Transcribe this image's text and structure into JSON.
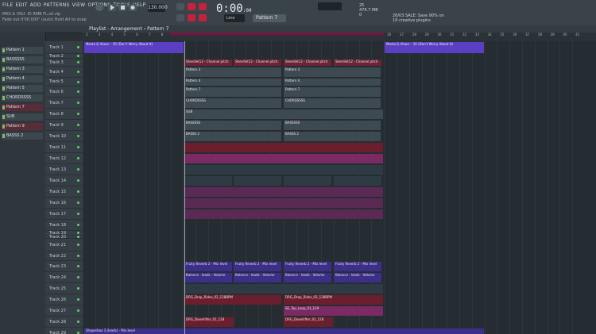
{
  "menu": [
    "FILE",
    "EDIT",
    "ADD",
    "PATTERNS",
    "VIEW",
    "OPTIONS",
    "TOOLS",
    "HELP"
  ],
  "hint": {
    "line1": "MKS & VKU- ID RMB FL.stl.zip",
    "line2": "Fade out   0'00.000\" (auto)    Hold Alt to snap"
  },
  "bpm": "130.000",
  "time": {
    "main": "0:00",
    "small": ":00"
  },
  "line_mode": "Line",
  "pattern": "Pattern 7",
  "cpu": {
    "a": "25",
    "b": "476.7 MB",
    "c": "0"
  },
  "news": {
    "line1": "26/03  SALE: Save 90% on",
    "line2": "19 creative plugins"
  },
  "playlist_title": "Playlist - Arrangement › Pattern 7",
  "channels": [
    "Pattern 1",
    "BASSSSS",
    "Pattern 3",
    "Pattern 4",
    "Pattern 5",
    "CHORDSSSS",
    "Pattern 7",
    "SUB",
    "Pattern 9",
    "BASSS 2"
  ],
  "tracks": [
    "Track 1",
    "Track 2",
    "Track 3",
    "Track 4",
    "Track 5",
    "Track 6",
    "Track 7",
    "Track 8",
    "Track 9",
    "Track 10",
    "Track 11",
    "Track 12",
    "Track 13",
    "Track 14",
    "Track 15",
    "Track 16",
    "Track 17",
    "Track 18",
    "Track 19",
    "Track 20",
    "Track 21",
    "Track 22",
    "Track 23",
    "Track 24",
    "Track 25",
    "Track 26",
    "Track 27",
    "Track 28",
    "Track 29"
  ],
  "ruler": [
    "2",
    "3",
    "4",
    "5",
    "6",
    "7",
    "8",
    "9",
    "10",
    "11",
    "12",
    "13",
    "14",
    "15",
    "16",
    "17",
    "18",
    "19",
    "20",
    "21",
    "22",
    "23",
    "24",
    "25",
    "26",
    "27",
    "28",
    "29",
    "30",
    "31",
    "32",
    "33",
    "34",
    "35",
    "36",
    "37",
    "38",
    "39",
    "40",
    "41"
  ],
  "clips": {
    "t1a": "Mesto & Vluarr - 30 (Don't Worry About It)",
    "t1b": "Mesto & Vluarr - 30 (Don't Worry About It)",
    "t3": "Sherdiet12 - Channel pitch",
    "t4": "Pattern 3",
    "t5": "Pattern 4",
    "t6": "Pattern 7",
    "t7": "CHORDSSSS",
    "t8": "SUB",
    "t9": "BASSSSS",
    "t10": "BASSS 2",
    "t23": "Fruity Reverb 2 - Mix level",
    "t24": "Balance - leads - Volume",
    "t26": "DRG_Drop_Rides_02_128BPM",
    "t27": "SE_Top_Loop_03_129",
    "t28": "DRG_Downlifter_01_128",
    "t29": "Shaperbox 3 (leads) - Mix level"
  }
}
